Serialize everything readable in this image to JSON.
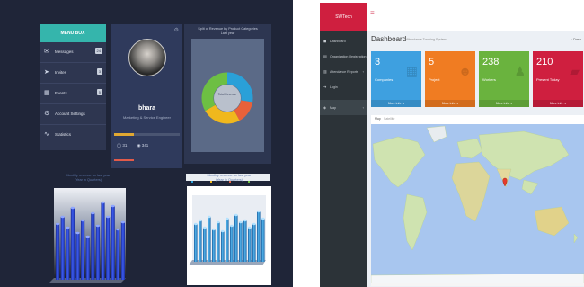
{
  "left_dashboard": {
    "menu": {
      "title": "MENU BOX",
      "items": [
        {
          "label": "Messages",
          "icon": "mail-icon",
          "badge": "24"
        },
        {
          "label": "Invites",
          "icon": "send-icon",
          "badge": "3"
        },
        {
          "label": "Events",
          "icon": "calendar-icon",
          "badge": "5"
        },
        {
          "label": "Account Settings",
          "icon": "gear-icon",
          "badge": ""
        },
        {
          "label": "Statistics",
          "icon": "chart-icon",
          "badge": ""
        }
      ]
    },
    "profile": {
      "name": "bhara",
      "role": "Marketing & Service Engineer",
      "comments": "31",
      "views": "341"
    },
    "donut": {
      "title": "Split of Revenue by Product Categories",
      "subtitle": "Last year",
      "center_text": "Total Revenue"
    },
    "chart1": {
      "title": "Monthly revenue for last year",
      "subtitle": "(Year in Quarters)"
    },
    "chart2": {
      "title": "Monthly revenue for last year",
      "subtitle": "(Year in Quarters)"
    }
  },
  "right_dashboard": {
    "brand": "SWTech",
    "page_title": "Dashboard",
    "page_subtitle": "Attendance Tracking System",
    "home": "Dash",
    "sidebar": [
      {
        "label": "Dashboard",
        "icon": "dashboard-icon"
      },
      {
        "label": "Organization Registration",
        "icon": "building-icon"
      },
      {
        "label": "Attendance Reports",
        "icon": "report-icon"
      },
      {
        "label": "Login",
        "icon": "login-icon"
      },
      {
        "label": "Map",
        "icon": "map-icon"
      }
    ],
    "tiles": [
      {
        "value": "3",
        "label": "Companies",
        "more": "More info",
        "color": "#3ea0e0"
      },
      {
        "value": "5",
        "label": "Project",
        "more": "More info",
        "color": "#f07c22"
      },
      {
        "value": "238",
        "label": "Workers",
        "more": "More info",
        "color": "#6ab33e"
      },
      {
        "value": "210",
        "label": "Present Today",
        "more": "More info",
        "color": "#cf1f3f"
      }
    ],
    "map_tabs": [
      "Map",
      "Satellite"
    ]
  },
  "colors": {
    "left_bg": "#1f2538",
    "menu_teal": "#35b5ac",
    "donut": [
      "#2aa0d8",
      "#f0b81d",
      "#e8613a",
      "#6dbf43"
    ],
    "bar_blue": "#2f4fd6",
    "bar_cyan": "#3fa9e0",
    "brand_red": "#cf1f3f"
  }
}
